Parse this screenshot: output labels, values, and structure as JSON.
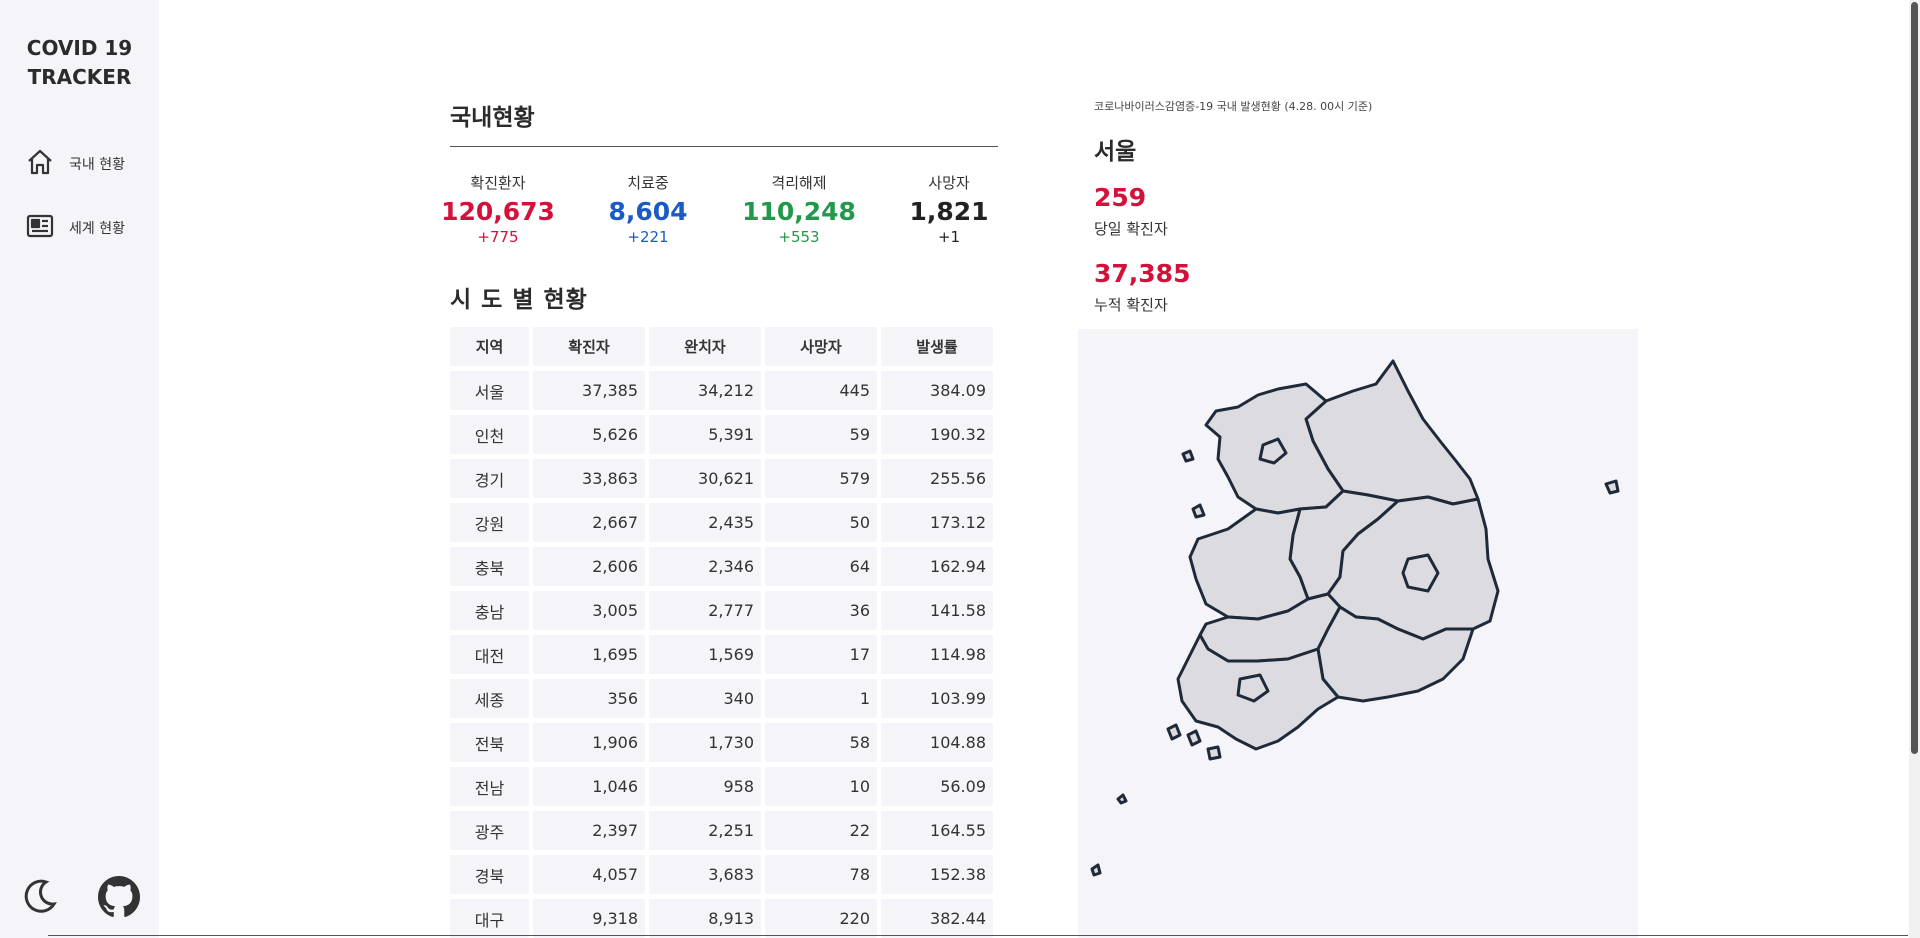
{
  "app": {
    "title_line1": "COVID 19",
    "title_line2": "TRACKER"
  },
  "sidebar": {
    "items": [
      {
        "label": "국내 현황",
        "icon": "home-icon"
      },
      {
        "label": "세계 현황",
        "icon": "newspaper-icon"
      }
    ],
    "footer_icons": [
      "moon-icon",
      "github-icon"
    ]
  },
  "main": {
    "title": "국내현황",
    "stats": [
      {
        "label": "확진환자",
        "value": "120,673",
        "delta": "+775",
        "color": "#d4113a"
      },
      {
        "label": "치료중",
        "value": "8,604",
        "delta": "+221",
        "color": "#1c5bc4"
      },
      {
        "label": "격리해제",
        "value": "110,248",
        "delta": "+553",
        "color": "#22994a"
      },
      {
        "label": "사망자",
        "value": "1,821",
        "delta": "+1",
        "color": "#222222"
      }
    ],
    "region_title": "시 도 별 현황",
    "table": {
      "headers": [
        "지역",
        "확진자",
        "완치자",
        "사망자",
        "발생률"
      ],
      "rows": [
        [
          "서울",
          "37,385",
          "34,212",
          "445",
          "384.09"
        ],
        [
          "인천",
          "5,626",
          "5,391",
          "59",
          "190.32"
        ],
        [
          "경기",
          "33,863",
          "30,621",
          "579",
          "255.56"
        ],
        [
          "강원",
          "2,667",
          "2,435",
          "50",
          "173.12"
        ],
        [
          "충북",
          "2,606",
          "2,346",
          "64",
          "162.94"
        ],
        [
          "충남",
          "3,005",
          "2,777",
          "36",
          "141.58"
        ],
        [
          "대전",
          "1,695",
          "1,569",
          "17",
          "114.98"
        ],
        [
          "세종",
          "356",
          "340",
          "1",
          "103.99"
        ],
        [
          "전북",
          "1,906",
          "1,730",
          "58",
          "104.88"
        ],
        [
          "전남",
          "1,046",
          "958",
          "10",
          "56.09"
        ],
        [
          "광주",
          "2,397",
          "2,251",
          "22",
          "164.55"
        ],
        [
          "경북",
          "4,057",
          "3,683",
          "78",
          "152.38"
        ],
        [
          "대구",
          "9,318",
          "8,913",
          "220",
          "382.44"
        ]
      ]
    }
  },
  "panel": {
    "caption": "코로나바이러스감염증-19 국내 발생현황 (4.28. 00시 기준)",
    "region": "서울",
    "today_value": "259",
    "today_label": "당일 확진자",
    "total_value": "37,385",
    "total_label": "누적 확진자"
  }
}
